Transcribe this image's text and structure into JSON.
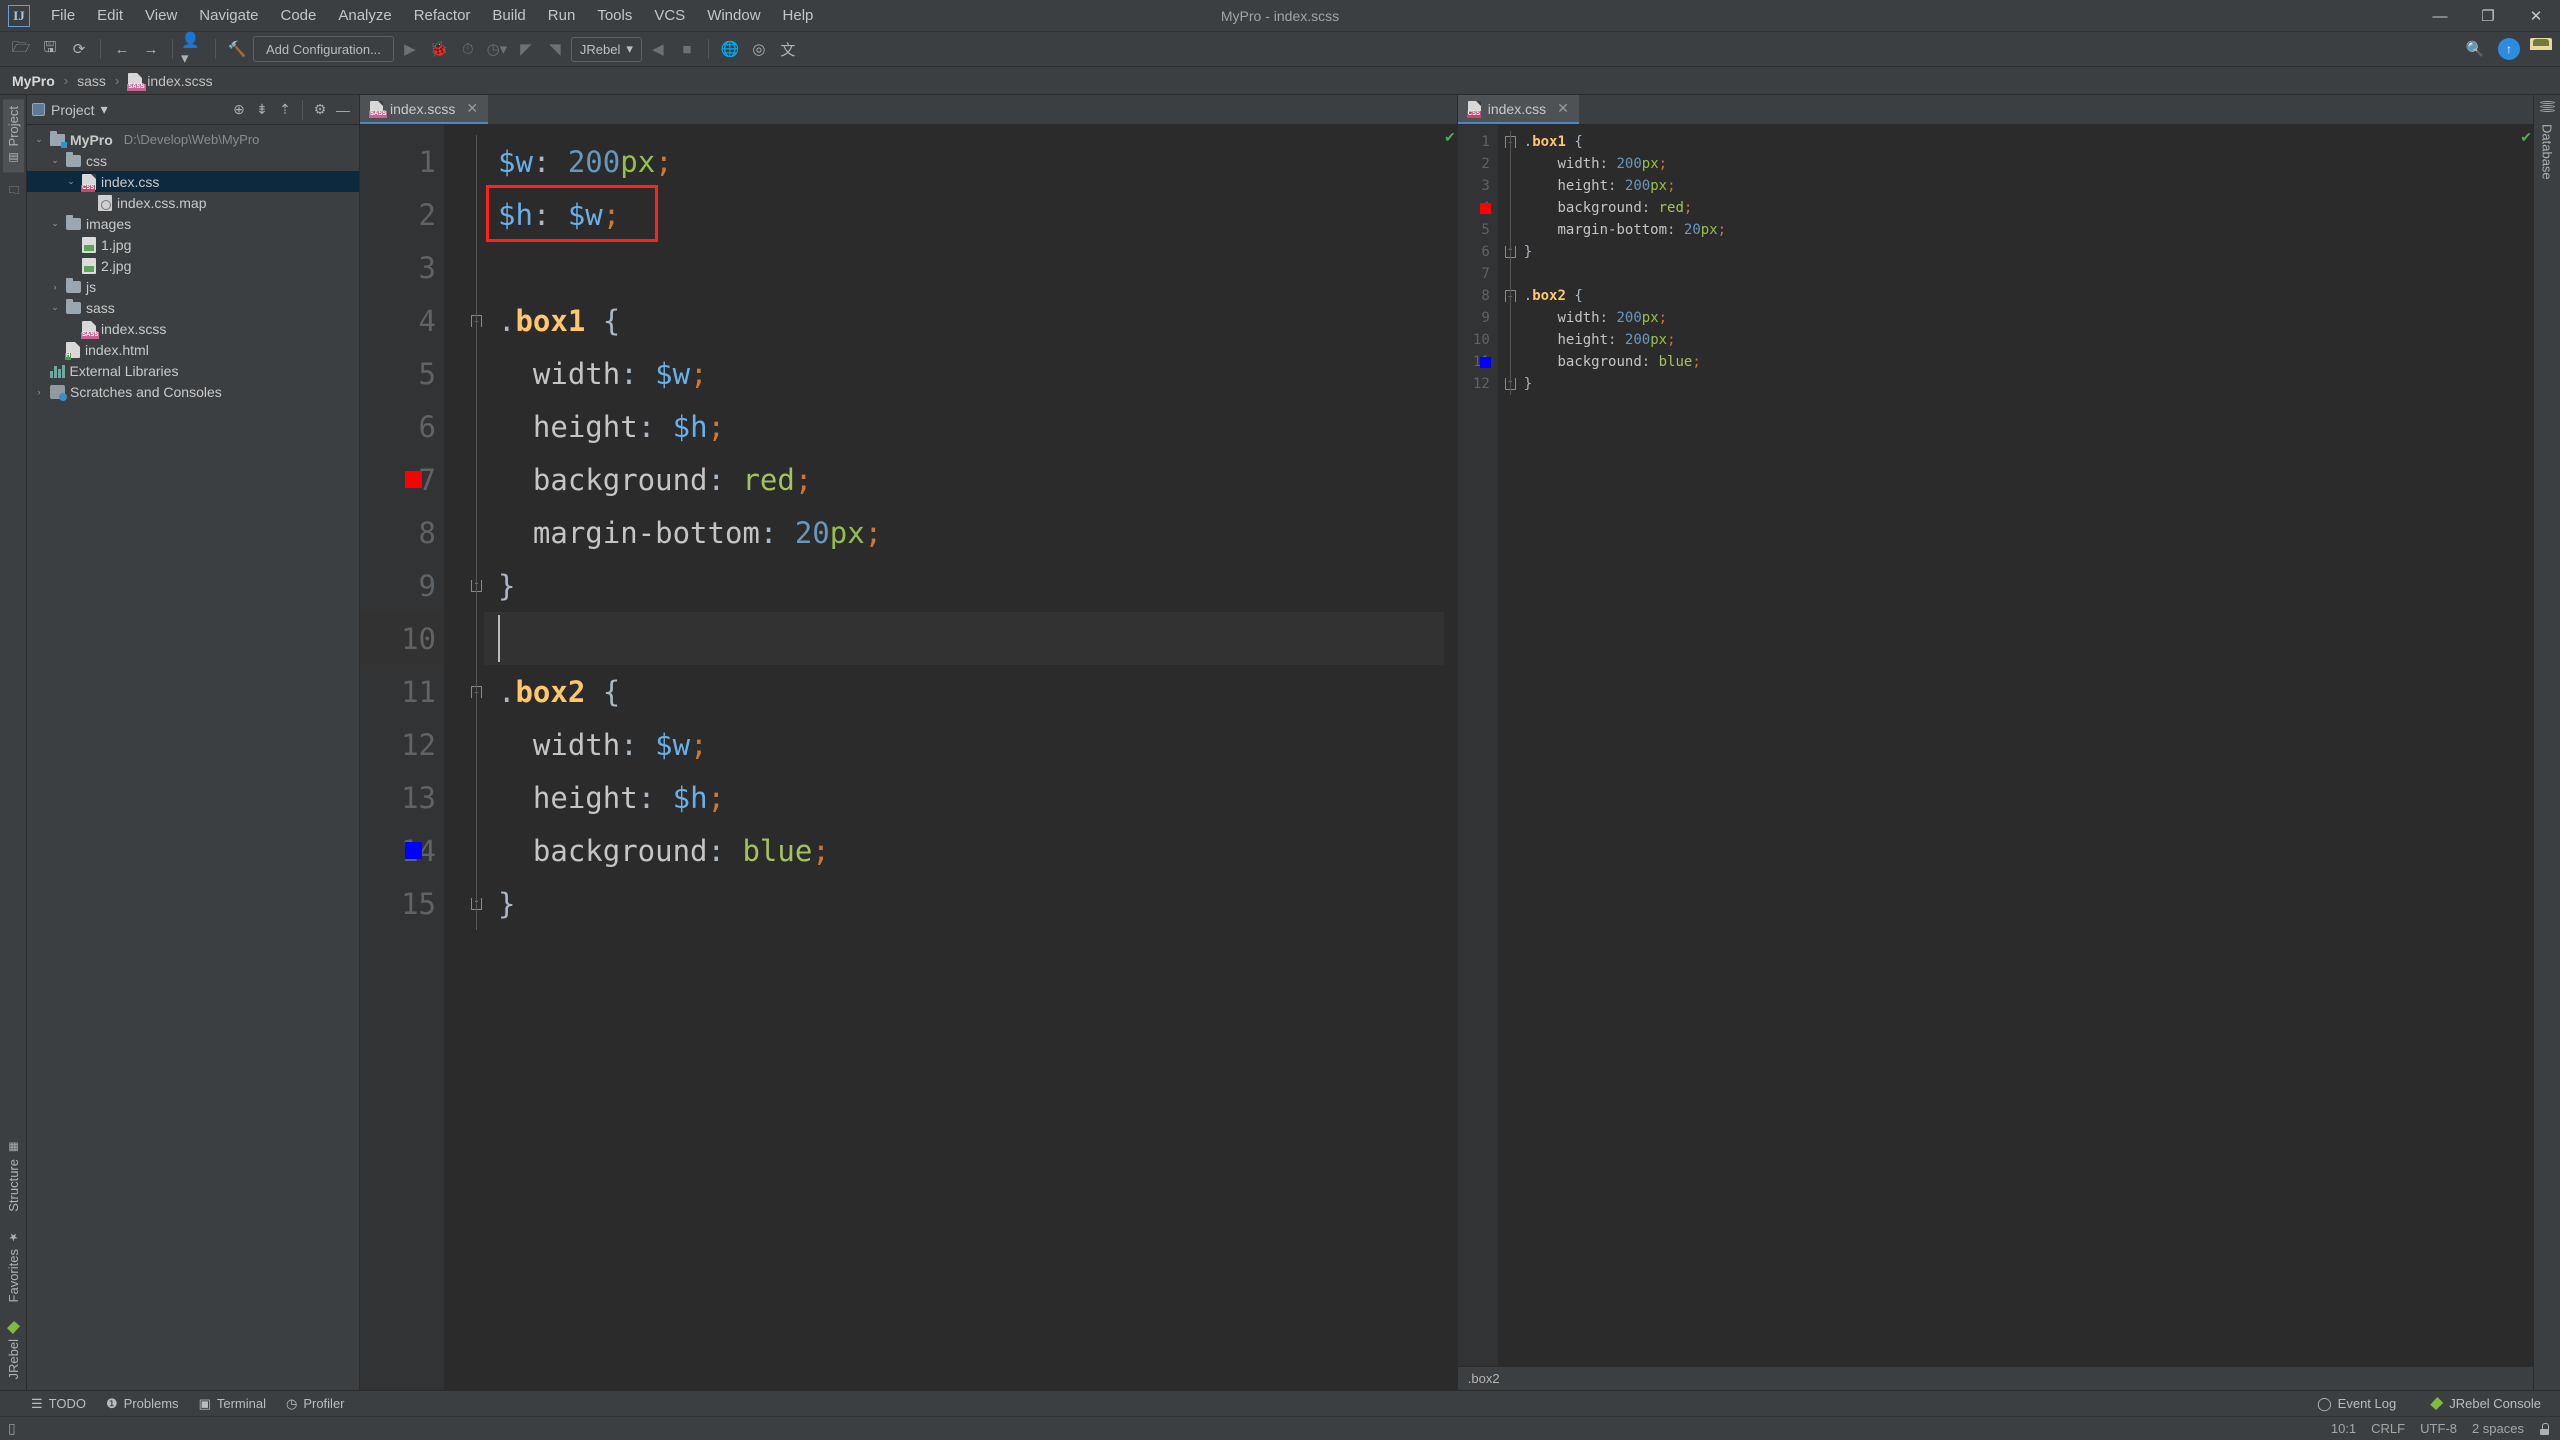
{
  "window": {
    "title": "MyPro - index.scss",
    "logo": "IJ",
    "minimize": "—",
    "maximize": "❐",
    "close": "✕"
  },
  "menu": [
    {
      "label": "File"
    },
    {
      "label": "Edit"
    },
    {
      "label": "View"
    },
    {
      "label": "Navigate"
    },
    {
      "label": "Code"
    },
    {
      "label": "Analyze"
    },
    {
      "label": "Refactor"
    },
    {
      "label": "Build"
    },
    {
      "label": "Run"
    },
    {
      "label": "Tools"
    },
    {
      "label": "VCS"
    },
    {
      "label": "Window"
    },
    {
      "label": "Help"
    }
  ],
  "toolbar": {
    "open_icon": "open-folder-icon",
    "save_icon": "save-icon",
    "sync_icon": "refresh-icon",
    "back_icon": "arrow-left-icon",
    "forward_icon": "arrow-right-icon",
    "profile_icon": "user-dropdown-icon",
    "build_icon": "hammer-icon",
    "run_config_label": "Add Configuration...",
    "run_icon": "play-icon",
    "debug_icon": "bug-icon",
    "run_coverage_icon": "coverage-icon",
    "profile_run_icon": "profiler-icon",
    "jrebel_run_icon": "jrebel-run-icon",
    "jrebel_debug_icon": "jrebel-debug-icon",
    "jrebel_label": "JRebel",
    "jrebel_caret": "▾",
    "attach_icon": "attach-icon",
    "stop_icon": "stop-icon",
    "globe_icon": "globe-icon",
    "search_icon": "search-icon",
    "update_icon": "update-arrow-icon",
    "avatar_icon": "avatar-icon"
  },
  "breadcrumb": {
    "items": [
      "MyPro",
      "sass",
      "index.scss"
    ],
    "separator": "›"
  },
  "project_panel": {
    "title": "Project",
    "caret": "▾",
    "icons": [
      "locate-icon",
      "expand-all-icon",
      "collapse-all-icon",
      "gear-icon",
      "hide-icon"
    ],
    "tree": [
      {
        "label": "MyPro",
        "path": "D:\\Develop\\Web\\MyPro",
        "indent": 0,
        "arrow": "⌄",
        "icon": "module-folder-icon",
        "bold": true,
        "selected": false
      },
      {
        "label": "css",
        "path": "",
        "indent": 1,
        "arrow": "⌄",
        "icon": "folder-icon",
        "bold": false,
        "selected": false
      },
      {
        "label": "index.css",
        "path": "",
        "indent": 2,
        "arrow": "⌄",
        "icon": "css-file-icon",
        "bold": false,
        "selected": true
      },
      {
        "label": "index.css.map",
        "path": "",
        "indent": 3,
        "arrow": "",
        "icon": "map-file-icon",
        "bold": false,
        "selected": false
      },
      {
        "label": "images",
        "path": "",
        "indent": 1,
        "arrow": "⌄",
        "icon": "folder-icon",
        "bold": false,
        "selected": false
      },
      {
        "label": "1.jpg",
        "path": "",
        "indent": 2,
        "arrow": "",
        "icon": "image-file-icon",
        "bold": false,
        "selected": false
      },
      {
        "label": "2.jpg",
        "path": "",
        "indent": 2,
        "arrow": "",
        "icon": "image-file-icon",
        "bold": false,
        "selected": false
      },
      {
        "label": "js",
        "path": "",
        "indent": 1,
        "arrow": "›",
        "icon": "folder-icon",
        "bold": false,
        "selected": false
      },
      {
        "label": "sass",
        "path": "",
        "indent": 1,
        "arrow": "⌄",
        "icon": "folder-icon",
        "bold": false,
        "selected": false
      },
      {
        "label": "index.scss",
        "path": "",
        "indent": 2,
        "arrow": "",
        "icon": "sass-file-icon",
        "bold": false,
        "selected": false
      },
      {
        "label": "index.html",
        "path": "",
        "indent": 1,
        "arrow": "",
        "icon": "html-file-icon",
        "bold": false,
        "selected": false
      },
      {
        "label": "External Libraries",
        "path": "",
        "indent": 0,
        "arrow": "",
        "icon": "libraries-icon",
        "bold": false,
        "selected": false
      },
      {
        "label": "Scratches and Consoles",
        "path": "",
        "indent": 0,
        "arrow": "›",
        "icon": "scratches-icon",
        "bold": false,
        "selected": false
      }
    ]
  },
  "left_rail": {
    "top": [
      {
        "label": "Project",
        "icon": "project-icon",
        "active": true
      },
      {
        "label": "",
        "icon": "folder-rail-icon",
        "active": false
      }
    ],
    "bottom": [
      {
        "label": "Structure",
        "icon": "structure-icon"
      },
      {
        "label": "Favorites",
        "icon": "star-icon"
      },
      {
        "label": "JRebel",
        "icon": "jrebel-icon"
      }
    ]
  },
  "right_rail": {
    "items": [
      {
        "label": "Database",
        "icon": "database-icon"
      }
    ]
  },
  "editor_left": {
    "tab": {
      "label": "index.scss",
      "icon": "sass-file-icon",
      "close": "✕"
    },
    "inspection_ok": "✔",
    "current_line": 10,
    "lines": [
      {
        "n": 1,
        "swatch": null,
        "fold": null,
        "tokens": [
          {
            "t": "$w",
            "c": "k-var"
          },
          {
            "t": ": ",
            "c": "k-plain"
          },
          {
            "t": "200",
            "c": "k-num"
          },
          {
            "t": "px",
            "c": "k-unit"
          },
          {
            "t": ";",
            "c": "k-semi"
          }
        ]
      },
      {
        "n": 2,
        "swatch": null,
        "fold": null,
        "tokens": [
          {
            "t": "$h",
            "c": "k-var"
          },
          {
            "t": ": ",
            "c": "k-plain"
          },
          {
            "t": "$w",
            "c": "k-var"
          },
          {
            "t": ";",
            "c": "k-semi"
          }
        ]
      },
      {
        "n": 3,
        "swatch": null,
        "fold": null,
        "tokens": []
      },
      {
        "n": 4,
        "swatch": null,
        "fold": "open",
        "tokens": [
          {
            "t": ".",
            "c": "k-dot"
          },
          {
            "t": "box1",
            "c": "k-sel"
          },
          {
            "t": " {",
            "c": "k-brace"
          }
        ]
      },
      {
        "n": 5,
        "swatch": null,
        "fold": null,
        "tokens": [
          {
            "t": "  width",
            "c": "k-prop"
          },
          {
            "t": ": ",
            "c": "k-plain"
          },
          {
            "t": "$w",
            "c": "k-var"
          },
          {
            "t": ";",
            "c": "k-semi"
          }
        ]
      },
      {
        "n": 6,
        "swatch": null,
        "fold": null,
        "tokens": [
          {
            "t": "  height",
            "c": "k-prop"
          },
          {
            "t": ": ",
            "c": "k-plain"
          },
          {
            "t": "$h",
            "c": "k-var"
          },
          {
            "t": ";",
            "c": "k-semi"
          }
        ]
      },
      {
        "n": 7,
        "swatch": "#ff0000",
        "fold": null,
        "tokens": [
          {
            "t": "  background",
            "c": "k-prop"
          },
          {
            "t": ": ",
            "c": "k-plain"
          },
          {
            "t": "red",
            "c": "k-val"
          },
          {
            "t": ";",
            "c": "k-semi"
          }
        ]
      },
      {
        "n": 8,
        "swatch": null,
        "fold": null,
        "tokens": [
          {
            "t": "  margin-bottom",
            "c": "k-prop"
          },
          {
            "t": ": ",
            "c": "k-plain"
          },
          {
            "t": "20",
            "c": "k-num"
          },
          {
            "t": "px",
            "c": "k-unit"
          },
          {
            "t": ";",
            "c": "k-semi"
          }
        ]
      },
      {
        "n": 9,
        "swatch": null,
        "fold": "close",
        "tokens": [
          {
            "t": "}",
            "c": "k-brace"
          }
        ]
      },
      {
        "n": 10,
        "swatch": null,
        "fold": null,
        "tokens": []
      },
      {
        "n": 11,
        "swatch": null,
        "fold": "open",
        "tokens": [
          {
            "t": ".",
            "c": "k-dot"
          },
          {
            "t": "box2",
            "c": "k-sel"
          },
          {
            "t": " {",
            "c": "k-brace"
          }
        ]
      },
      {
        "n": 12,
        "swatch": null,
        "fold": null,
        "tokens": [
          {
            "t": "  width",
            "c": "k-prop"
          },
          {
            "t": ": ",
            "c": "k-plain"
          },
          {
            "t": "$w",
            "c": "k-var"
          },
          {
            "t": ";",
            "c": "k-semi"
          }
        ]
      },
      {
        "n": 13,
        "swatch": null,
        "fold": null,
        "tokens": [
          {
            "t": "  height",
            "c": "k-prop"
          },
          {
            "t": ": ",
            "c": "k-plain"
          },
          {
            "t": "$h",
            "c": "k-var"
          },
          {
            "t": ";",
            "c": "k-semi"
          }
        ]
      },
      {
        "n": 14,
        "swatch": "#0000ff",
        "fold": null,
        "tokens": [
          {
            "t": "  background",
            "c": "k-prop"
          },
          {
            "t": ": ",
            "c": "k-plain"
          },
          {
            "t": "blue",
            "c": "k-val"
          },
          {
            "t": ";",
            "c": "k-semi"
          }
        ]
      },
      {
        "n": 15,
        "swatch": null,
        "fold": "close",
        "tokens": [
          {
            "t": "}",
            "c": "k-brace"
          }
        ]
      }
    ],
    "highlight_box": {
      "line": 2,
      "color": "#ff2020"
    }
  },
  "editor_right": {
    "tab": {
      "label": "index.css",
      "icon": "css-file-icon",
      "close": "✕"
    },
    "inspection_ok": "✔",
    "lines": [
      {
        "n": 1,
        "swatch": null,
        "fold": "open",
        "tokens": [
          {
            "t": ".",
            "c": "k-dot"
          },
          {
            "t": "box1",
            "c": "k-sel"
          },
          {
            "t": " {",
            "c": "k-brace"
          }
        ]
      },
      {
        "n": 2,
        "swatch": null,
        "fold": null,
        "tokens": [
          {
            "t": "    width",
            "c": "k-prop"
          },
          {
            "t": ": ",
            "c": "k-plain"
          },
          {
            "t": "200",
            "c": "k-num"
          },
          {
            "t": "px",
            "c": "k-unit"
          },
          {
            "t": ";",
            "c": "k-semi"
          }
        ]
      },
      {
        "n": 3,
        "swatch": null,
        "fold": null,
        "tokens": [
          {
            "t": "    height",
            "c": "k-prop"
          },
          {
            "t": ": ",
            "c": "k-plain"
          },
          {
            "t": "200",
            "c": "k-num"
          },
          {
            "t": "px",
            "c": "k-unit"
          },
          {
            "t": ";",
            "c": "k-semi"
          }
        ]
      },
      {
        "n": 4,
        "swatch": "#ff0000",
        "fold": null,
        "tokens": [
          {
            "t": "    background",
            "c": "k-prop"
          },
          {
            "t": ": ",
            "c": "k-plain"
          },
          {
            "t": "red",
            "c": "k-val"
          },
          {
            "t": ";",
            "c": "k-semi"
          }
        ]
      },
      {
        "n": 5,
        "swatch": null,
        "fold": null,
        "tokens": [
          {
            "t": "    margin-bottom",
            "c": "k-prop"
          },
          {
            "t": ": ",
            "c": "k-plain"
          },
          {
            "t": "20",
            "c": "k-num"
          },
          {
            "t": "px",
            "c": "k-unit"
          },
          {
            "t": ";",
            "c": "k-semi"
          }
        ]
      },
      {
        "n": 6,
        "swatch": null,
        "fold": "close",
        "tokens": [
          {
            "t": "}",
            "c": "k-brace"
          }
        ]
      },
      {
        "n": 7,
        "swatch": null,
        "fold": null,
        "tokens": []
      },
      {
        "n": 8,
        "swatch": null,
        "fold": "open",
        "tokens": [
          {
            "t": ".",
            "c": "k-dot"
          },
          {
            "t": "box2",
            "c": "k-sel"
          },
          {
            "t": " {",
            "c": "k-brace"
          }
        ]
      },
      {
        "n": 9,
        "swatch": null,
        "fold": null,
        "tokens": [
          {
            "t": "    width",
            "c": "k-prop"
          },
          {
            "t": ": ",
            "c": "k-plain"
          },
          {
            "t": "200",
            "c": "k-num"
          },
          {
            "t": "px",
            "c": "k-unit"
          },
          {
            "t": ";",
            "c": "k-semi"
          }
        ]
      },
      {
        "n": 10,
        "swatch": null,
        "fold": null,
        "tokens": [
          {
            "t": "    height",
            "c": "k-prop"
          },
          {
            "t": ": ",
            "c": "k-plain"
          },
          {
            "t": "200",
            "c": "k-num"
          },
          {
            "t": "px",
            "c": "k-unit"
          },
          {
            "t": ";",
            "c": "k-semi"
          }
        ]
      },
      {
        "n": 11,
        "swatch": "#0000ff",
        "fold": null,
        "tokens": [
          {
            "t": "    background",
            "c": "k-prop"
          },
          {
            "t": ": ",
            "c": "k-plain"
          },
          {
            "t": "blue",
            "c": "k-val"
          },
          {
            "t": ";",
            "c": "k-semi"
          }
        ]
      },
      {
        "n": 12,
        "swatch": null,
        "fold": "close",
        "tokens": [
          {
            "t": "}",
            "c": "k-brace"
          }
        ]
      }
    ],
    "bottom_breadcrumb": ".box2"
  },
  "tool_window_bar": {
    "items": [
      {
        "label": "TODO",
        "icon": "todo-icon"
      },
      {
        "label": "Problems",
        "icon": "problems-icon"
      },
      {
        "label": "Terminal",
        "icon": "terminal-icon"
      },
      {
        "label": "Profiler",
        "icon": "profiler-icon"
      }
    ],
    "right": [
      {
        "label": "Event Log",
        "icon": "event-log-icon"
      },
      {
        "label": "JRebel Console",
        "icon": "jrebel-icon"
      }
    ]
  },
  "status_bar": {
    "left_icon": "memory-icon",
    "position": "10:1",
    "line_separator": "CRLF",
    "encoding": "UTF-8",
    "indent": "2 spaces",
    "lock_icon": "lock-icon"
  }
}
